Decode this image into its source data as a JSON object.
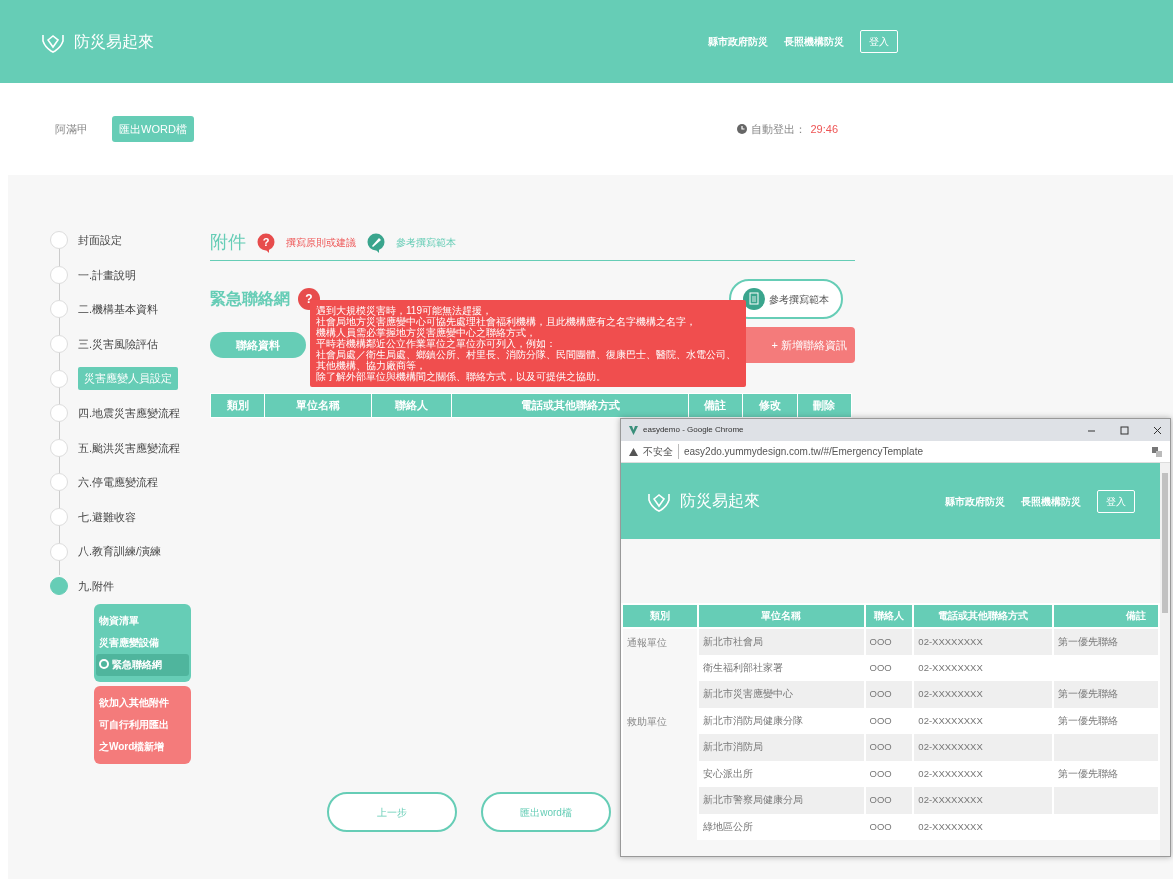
{
  "header": {
    "brand": "防災易起來",
    "links": [
      "縣市政府防災",
      "長照機構防災"
    ],
    "login": "登入"
  },
  "toolbar": {
    "user": "阿滿甲",
    "export_button": "匯出WORD檔",
    "logout_label": "自動登出：",
    "logout_time": "29:46"
  },
  "sidebar": {
    "items": [
      {
        "label": "封面設定",
        "kind": "step",
        "selected": false
      },
      {
        "label": "一.計畫說明",
        "kind": "step",
        "selected": false
      },
      {
        "label": "二.機構基本資料",
        "kind": "step",
        "selected": false
      },
      {
        "label": "三.災害風險評估",
        "kind": "step",
        "selected": false
      },
      {
        "label": "災害應變人員設定",
        "kind": "tag",
        "selected": false
      },
      {
        "label": "四.地震災害應變流程",
        "kind": "step",
        "selected": false
      },
      {
        "label": "五.颱洪災害應變流程",
        "kind": "step",
        "selected": false
      },
      {
        "label": "六.停電應變流程",
        "kind": "step",
        "selected": false
      },
      {
        "label": "七.避難收容",
        "kind": "step",
        "selected": false
      },
      {
        "label": "八.教育訓練/演練",
        "kind": "step",
        "selected": false
      },
      {
        "label": "九.附件",
        "kind": "step",
        "selected": true
      }
    ],
    "sub_items": [
      {
        "label": "物資清單",
        "selected": false
      },
      {
        "label": "災害應變設備",
        "selected": false
      },
      {
        "label": "緊急聯絡網",
        "selected": true
      }
    ],
    "note": [
      "欲加入其他附件",
      "可自行利用匯出",
      "之Word檔新增"
    ]
  },
  "section": {
    "title": "附件",
    "hint_icon": "?",
    "hint_link": "撰寫原則或建議",
    "sample_link": "參考撰寫範本"
  },
  "subsection": {
    "title": "緊急聯絡網",
    "help_icon": "?",
    "sample_button": "參考撰寫範本"
  },
  "tooltip": [
    "遇到大規模災害時，119可能無法趕援，",
    "社會局地方災害應變中心可協先處理社會福利機構，且此機構應有之名字機構之名字，",
    "機構人員需必掌握地方災害應變中心之聯絡方式，",
    "平時若機構鄰近公立作業單位之單位亦可列入，例如：",
    "社會局處／衛生局處、鄉鎮公所、村里長、消防分隊、民間團體、復康巴士、醫院、水電公司、其他機構、協力廠商等，",
    "除了解外部單位與機構間之關係、聯絡方式，以及可提供之協助。"
  ],
  "tabs": [
    {
      "label": "聯絡資料",
      "selected": true
    }
  ],
  "add_button": "+ 新增聯絡資訊",
  "table": {
    "columns": [
      "類別",
      "單位名稱",
      "聯絡人",
      "電話或其他聯絡方式",
      "備註",
      "修改",
      "刪除"
    ]
  },
  "footer_buttons": [
    "上一步",
    "匯出word檔"
  ],
  "popup": {
    "title": "easydemo - Google Chrome",
    "security": "不安全",
    "url": "easy2do.yummydesign.com.tw/#/EmergencyTemplate",
    "header": {
      "brand": "防災易起來",
      "links": [
        "縣市政府防災",
        "長照機構防災"
      ],
      "login": "登入"
    },
    "columns": [
      "類別",
      "單位名稱",
      "聯絡人",
      "電話或其他聯絡方式",
      "備註"
    ],
    "groups": [
      {
        "category": "通報單位",
        "rows": [
          {
            "unit": "新北市社會局",
            "contact": "OOO",
            "phone": "02-XXXXXXXX",
            "note": "第一優先聯絡"
          },
          {
            "unit": "衛生福利部社家署",
            "contact": "OOO",
            "phone": "02-XXXXXXXX"
          },
          {
            "unit": "新北市災害應變中心",
            "contact": "OOO",
            "phone": "02-XXXXXXXX",
            "note": "第一優先聯絡"
          }
        ]
      },
      {
        "category": "救助單位",
        "rows": [
          {
            "unit": "新北市消防局健康分隊",
            "contact": "OOO",
            "phone": "02-XXXXXXXX",
            "note": "第一優先聯絡"
          },
          {
            "unit": "新北市消防局",
            "contact": "OOO",
            "phone": "02-XXXXXXXX"
          },
          {
            "unit": "安心派出所",
            "contact": "OOO",
            "phone": "02-XXXXXXXX",
            "note": "第一優先聯絡"
          },
          {
            "unit": "新北市警察局健康分局",
            "contact": "OOO",
            "phone": "02-XXXXXXXX"
          },
          {
            "unit": "綠地區公所",
            "contact": "OOO",
            "phone": "02-XXXXXXXX"
          }
        ]
      }
    ]
  }
}
